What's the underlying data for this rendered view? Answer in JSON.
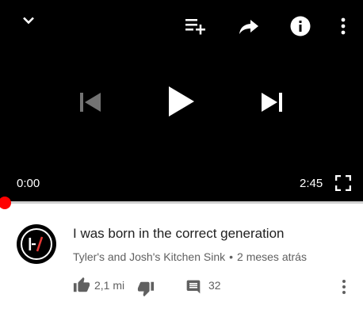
{
  "player": {
    "current_time": "0:00",
    "duration": "2:45",
    "progress": 0,
    "top_icons": [
      "chevron-down-icon",
      "add-to-queue-icon",
      "share-icon",
      "info-icon",
      "more-vert-icon"
    ],
    "controls": [
      "skip-previous-icon",
      "play-icon",
      "skip-next-icon"
    ],
    "fullscreen_icon": "fullscreen-icon"
  },
  "video": {
    "title": "I was born in the correct generation",
    "channel": "Tyler's and Josh's Kitchen Sink",
    "separator": "•",
    "uploaded": "2 meses atrás",
    "likes": "2,1 mi",
    "comments": "32"
  },
  "colors": {
    "player_bg": "#000000",
    "scrubber": "#ff0000",
    "avatar_accent": "#e53935",
    "text_primary": "#212121",
    "text_secondary": "#606060"
  }
}
